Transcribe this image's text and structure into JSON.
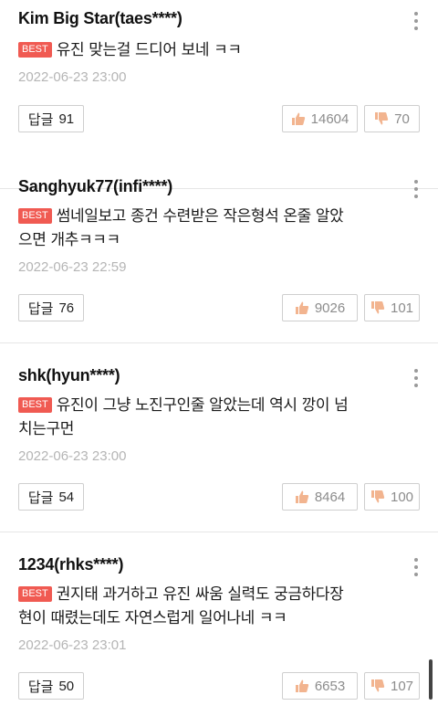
{
  "comments": [
    {
      "author": "Kim Big Star(taes****)",
      "badge": "BEST",
      "text_lines": [
        "유진 맞는걸 드디어 보네 ㅋㅋ"
      ],
      "date": "2022-06-23 23:00",
      "reply_label": "답글",
      "reply_count": "91",
      "likes": "14604",
      "dislikes": "70"
    },
    {
      "author": "Sanghyuk77(infi****)",
      "badge": "BEST",
      "text_lines": [
        "썸네일보고 종건 수련받은 작은형석 온줄 알았",
        "으면 개추ㅋㅋㅋ"
      ],
      "date": "2022-06-23 22:59",
      "reply_label": "답글",
      "reply_count": "76",
      "likes": "9026",
      "dislikes": "101"
    },
    {
      "author": "shk(hyun****)",
      "badge": "BEST",
      "text_lines": [
        "유진이 그냥 노진구인줄 알았는데 역시 깡이 넘",
        "치는구먼"
      ],
      "date": "2022-06-23 23:00",
      "reply_label": "답글",
      "reply_count": "54",
      "likes": "8464",
      "dislikes": "100"
    },
    {
      "author": "1234(rhks****)",
      "badge": "BEST",
      "text_lines": [
        "권지태 과거하고 유진 싸움 실력도 궁금하다장",
        "현이 때렸는데도 자연스럽게 일어나네 ㅋㅋ"
      ],
      "date": "2022-06-23 23:01",
      "reply_label": "답글",
      "reply_count": "50",
      "likes": "6653",
      "dislikes": "107"
    }
  ],
  "colors": {
    "badge": "#f05a52",
    "thumb": "#f2b48f",
    "meta": "#b5b5b5"
  },
  "icons": [
    "more-vertical-icon",
    "thumbs-up-icon",
    "thumbs-down-icon"
  ]
}
